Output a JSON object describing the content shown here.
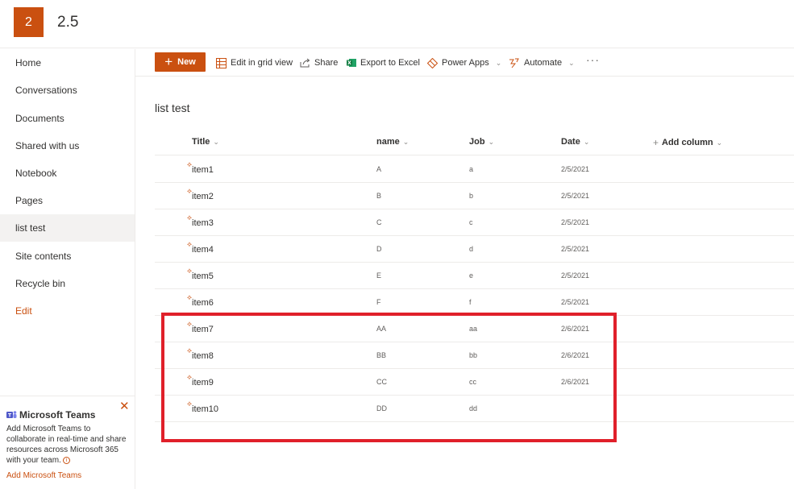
{
  "site": {
    "logo_letter": "2",
    "title": "2.5"
  },
  "nav": {
    "items": [
      {
        "label": "Home"
      },
      {
        "label": "Conversations"
      },
      {
        "label": "Documents"
      },
      {
        "label": "Shared with us"
      },
      {
        "label": "Notebook"
      },
      {
        "label": "Pages"
      },
      {
        "label": "list test",
        "selected": true
      },
      {
        "label": "Site contents"
      },
      {
        "label": "Recycle bin"
      }
    ],
    "edit_label": "Edit"
  },
  "teams": {
    "title": "Microsoft Teams",
    "description": "Add Microsoft Teams to collaborate in real-time and share resources across Microsoft 365 with your team.",
    "link": "Add Microsoft Teams",
    "close": "✕"
  },
  "commands": {
    "new_label": "New",
    "edit_grid": "Edit in grid view",
    "share": "Share",
    "export": "Export to Excel",
    "power_apps": "Power Apps",
    "automate": "Automate",
    "more": "···"
  },
  "list": {
    "title": "list test",
    "columns": {
      "title": "Title",
      "name": "name",
      "job": "Job",
      "date": "Date",
      "add": "Add column"
    },
    "rows": [
      {
        "title": "item1",
        "name": "A",
        "job": "a",
        "date": "2/5/2021"
      },
      {
        "title": "item2",
        "name": "B",
        "job": "b",
        "date": "2/5/2021"
      },
      {
        "title": "item3",
        "name": "C",
        "job": "c",
        "date": "2/5/2021"
      },
      {
        "title": "item4",
        "name": "D",
        "job": "d",
        "date": "2/5/2021"
      },
      {
        "title": "item5",
        "name": "E",
        "job": "e",
        "date": "2/5/2021"
      },
      {
        "title": "item6",
        "name": "F",
        "job": "f",
        "date": "2/5/2021"
      },
      {
        "title": "item7",
        "name": "AA",
        "job": "aa",
        "date": "2/6/2021"
      },
      {
        "title": "item8",
        "name": "BB",
        "job": "bb",
        "date": "2/6/2021"
      },
      {
        "title": "item9",
        "name": "CC",
        "job": "cc",
        "date": "2/6/2021"
      },
      {
        "title": "item10",
        "name": "DD",
        "job": "dd",
        "date": ""
      }
    ]
  },
  "colors": {
    "accent": "#ca5010",
    "highlight": "#e0202a"
  }
}
